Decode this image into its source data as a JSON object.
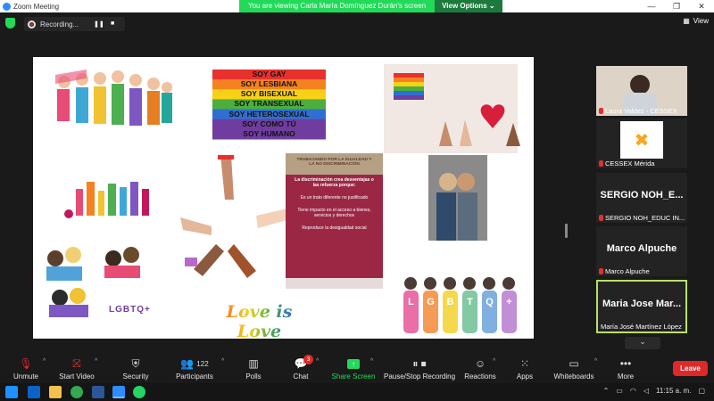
{
  "titlebar": {
    "app_title": "Zoom Meeting",
    "banner_text": "You are viewing Carla María Domínguez Durán's screen",
    "view_options": "View Options",
    "minimize": "—",
    "maximize": "❐",
    "close": "✕"
  },
  "topbar": {
    "recording_label": "Recording...",
    "pause_icon": "❚❚",
    "stop_icon": "■",
    "view_label": "View",
    "view_icon": "▦"
  },
  "slide": {
    "pride_flag_lines": [
      "SOY GAY",
      "SOY LESBIANA",
      "SOY BISEXUAL",
      "SOY TRANSEXUAL",
      "SOY HETEROSEXUAL",
      "SOY COMO TÚ",
      "SOY HUMANO"
    ],
    "flag_colors": [
      "#e8302d",
      "#f58220",
      "#f7d117",
      "#4cae3d",
      "#2f6fd1",
      "#6f3d9f",
      "#6f3d9f"
    ],
    "poster": {
      "header": "TRABAJANDO POR LA IGUALDAD Y LA NO DISCRIMINACIÓN",
      "title": "La discriminación crea desventajas o las refuerza porque:",
      "items": [
        "Es un trato diferente no justificado",
        "Tiene impacto en el acceso a bienes, servicios y derechos",
        "Reproduce la desigualdad social"
      ]
    },
    "love_is_love": "Love is Love",
    "lgbtq_sticker": "LGBTQ+",
    "lgbtq_letters": [
      "L",
      "G",
      "B",
      "T",
      "Q",
      "+"
    ],
    "lgbtq_colors": [
      "#e96fa6",
      "#f59b55",
      "#f5d84b",
      "#82c9a4",
      "#7fb0e0",
      "#c08fd6"
    ]
  },
  "participants_panel": [
    {
      "name": "Laura Valdez - CESSEX",
      "display": "",
      "muted": true
    },
    {
      "name": "CESSEX Mérida",
      "display": "",
      "muted": true
    },
    {
      "name": "SERGIO NOH_EDUC IN...",
      "display": "SERGIO NOH_E...",
      "muted": true
    },
    {
      "name": "Marco Alpuche",
      "display": "Marco Alpuche",
      "muted": true
    },
    {
      "name": "María José Martínez López",
      "display": "Maria Jose Mar...",
      "muted": false
    }
  ],
  "toolbar": {
    "unmute": "Unmute",
    "start_video": "Start Video",
    "security": "Security",
    "participants": "Participants",
    "participants_count": "122",
    "polls": "Polls",
    "chat": "Chat",
    "chat_badge": "3",
    "share_screen": "Share Screen",
    "record": "Pause/Stop Recording",
    "reactions": "Reactions",
    "apps": "Apps",
    "whiteboards": "Whiteboards",
    "more": "More",
    "leave": "Leave"
  },
  "taskbar": {
    "time": "11:15 a. m.",
    "scroll_down": "⌄"
  },
  "colors": {
    "accent_green": "#23d959",
    "leave_red": "#e02828",
    "active_border": "#b9e06a",
    "poster_bg": "#9b2745",
    "poster_header": "#b6a084"
  }
}
